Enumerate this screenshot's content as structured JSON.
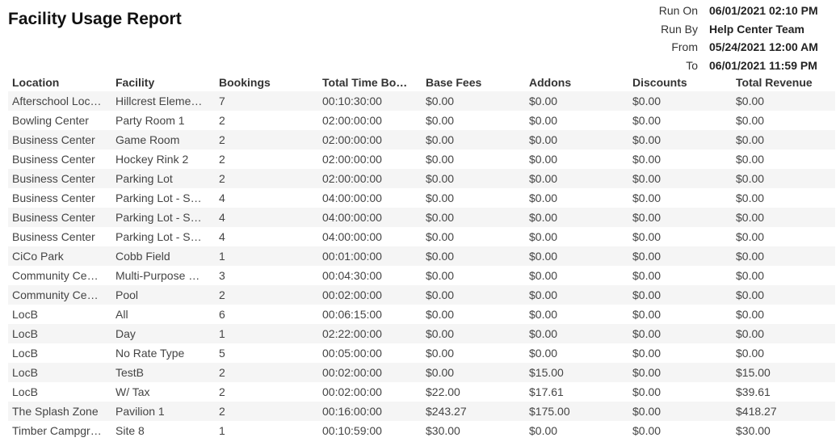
{
  "report": {
    "title": "Facility Usage Report",
    "meta": [
      {
        "label": "Run On",
        "value": "06/01/2021 02:10 PM"
      },
      {
        "label": "Run By",
        "value": "Help Center Team"
      },
      {
        "label": "From",
        "value": "05/24/2021 12:00 AM"
      },
      {
        "label": "To",
        "value": "06/01/2021 11:59 PM"
      }
    ],
    "columns": [
      "Location",
      "Facility",
      "Bookings",
      "Total Time Bo…",
      "Base Fees",
      "Addons",
      "Discounts",
      "Total Revenue"
    ],
    "rows": [
      [
        "Afterschool Loc…",
        "Hillcrest Eleme…",
        "7",
        "00:10:30:00",
        "$0.00",
        "$0.00",
        "$0.00",
        "$0.00"
      ],
      [
        "Bowling Center",
        "Party Room 1",
        "2",
        "02:00:00:00",
        "$0.00",
        "$0.00",
        "$0.00",
        "$0.00"
      ],
      [
        "Business Center",
        "Game Room",
        "2",
        "02:00:00:00",
        "$0.00",
        "$0.00",
        "$0.00",
        "$0.00"
      ],
      [
        "Business Center",
        "Hockey Rink 2",
        "2",
        "02:00:00:00",
        "$0.00",
        "$0.00",
        "$0.00",
        "$0.00"
      ],
      [
        "Business Center",
        "Parking Lot",
        "2",
        "02:00:00:00",
        "$0.00",
        "$0.00",
        "$0.00",
        "$0.00"
      ],
      [
        "Business Center",
        "Parking Lot - S…",
        "4",
        "04:00:00:00",
        "$0.00",
        "$0.00",
        "$0.00",
        "$0.00"
      ],
      [
        "Business Center",
        "Parking Lot - S…",
        "4",
        "04:00:00:00",
        "$0.00",
        "$0.00",
        "$0.00",
        "$0.00"
      ],
      [
        "Business Center",
        "Parking Lot - S…",
        "4",
        "04:00:00:00",
        "$0.00",
        "$0.00",
        "$0.00",
        "$0.00"
      ],
      [
        "CiCo Park",
        "Cobb Field",
        "1",
        "00:01:00:00",
        "$0.00",
        "$0.00",
        "$0.00",
        "$0.00"
      ],
      [
        "Community Ce…",
        "Multi-Purpose …",
        "3",
        "00:04:30:00",
        "$0.00",
        "$0.00",
        "$0.00",
        "$0.00"
      ],
      [
        "Community Ce…",
        "Pool",
        "2",
        "00:02:00:00",
        "$0.00",
        "$0.00",
        "$0.00",
        "$0.00"
      ],
      [
        "LocB",
        "All",
        "6",
        "00:06:15:00",
        "$0.00",
        "$0.00",
        "$0.00",
        "$0.00"
      ],
      [
        "LocB",
        "Day",
        "1",
        "02:22:00:00",
        "$0.00",
        "$0.00",
        "$0.00",
        "$0.00"
      ],
      [
        "LocB",
        "No Rate Type",
        "5",
        "00:05:00:00",
        "$0.00",
        "$0.00",
        "$0.00",
        "$0.00"
      ],
      [
        "LocB",
        "TestB",
        "2",
        "00:02:00:00",
        "$0.00",
        "$15.00",
        "$0.00",
        "$15.00"
      ],
      [
        "LocB",
        "W/ Tax",
        "2",
        "00:02:00:00",
        "$22.00",
        "$17.61",
        "$0.00",
        "$39.61"
      ],
      [
        "The Splash Zone",
        "Pavilion 1",
        "2",
        "00:16:00:00",
        "$243.27",
        "$175.00",
        "$0.00",
        "$418.27"
      ],
      [
        "Timber Campgr…",
        "Site 8",
        "1",
        "00:10:59:00",
        "$30.00",
        "$0.00",
        "$0.00",
        "$30.00"
      ]
    ]
  }
}
